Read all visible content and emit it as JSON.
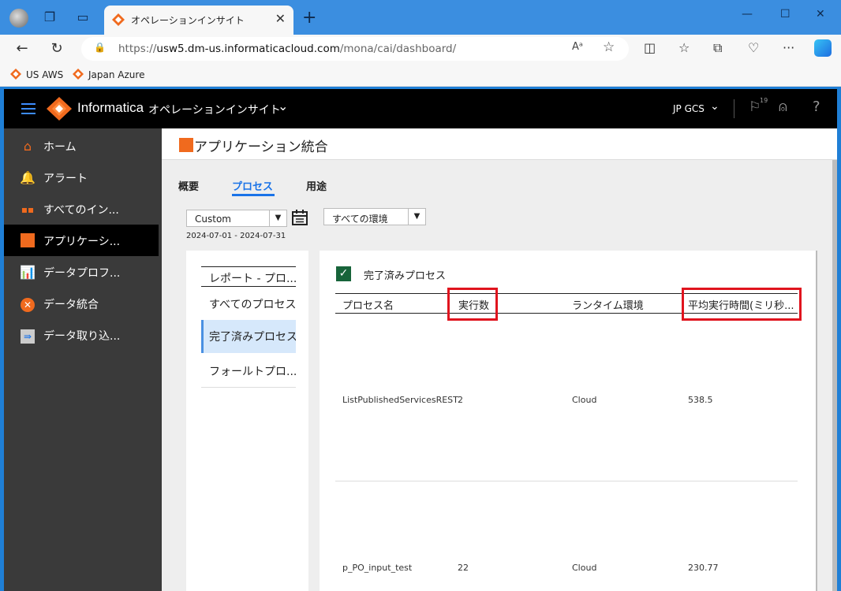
{
  "browser": {
    "tab_title": "オペレーションインサイト",
    "url_prefix": "https://",
    "url_host": "usw5.dm-us.informaticacloud.com",
    "url_path": "/mona/cai/dashboard/",
    "bookmarks": [
      "US AWS",
      "Japan Azure"
    ]
  },
  "app": {
    "brand": "Informatica",
    "name": "オペレーションインサイト",
    "org": "JP GCS",
    "notification_count": "19"
  },
  "sidebar": {
    "items": [
      {
        "label": "ホーム",
        "icon": "home-icon"
      },
      {
        "label": "アラート",
        "icon": "bell-icon"
      },
      {
        "label": "すべてのイン...",
        "icon": "grid-icon"
      },
      {
        "label": "アプリケーシ...",
        "icon": "app-integration-icon"
      },
      {
        "label": "データプロフ...",
        "icon": "bar-chart-icon"
      },
      {
        "label": "データ統合",
        "icon": "data-integration-icon"
      },
      {
        "label": "データ取り込...",
        "icon": "ingestion-icon"
      }
    ]
  },
  "page": {
    "title": "アプリケーション統合",
    "tabs": [
      "概要",
      "プロセス",
      "用途"
    ],
    "active_tab": "プロセス",
    "date_filter": "Custom",
    "date_range": "2024-07-01 - 2024-07-31",
    "env_filter": "すべての環境"
  },
  "reports": {
    "header": "レポート - プロ...",
    "items": [
      "すべてのプロセス",
      "完了済みプロセス",
      "フォールトプロ..."
    ],
    "selected": "完了済みプロセス"
  },
  "table": {
    "title": "完了済みプロセス",
    "columns": [
      "プロセス名",
      "実行数",
      "ランタイム環境",
      "平均実行時間(ミリ秒..."
    ],
    "rows": [
      [
        "ListPublishedServicesREST",
        "2",
        "Cloud",
        "538.5"
      ],
      [
        "p_PO_input_test",
        "22",
        "Cloud",
        "230.77"
      ]
    ]
  },
  "colors": {
    "brand_orange": "#f06a1e",
    "active_blue": "#1a73e8",
    "highlight_red": "#e0141e",
    "check_green": "#17643a"
  }
}
